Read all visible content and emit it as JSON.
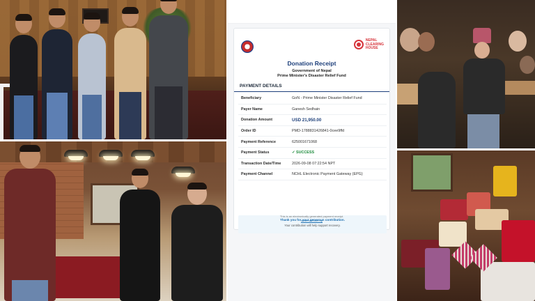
{
  "receipt": {
    "title": "Donation Receipt",
    "government": "Government of Nepal",
    "fund": "Prime Minister's Disaster Relief Fund",
    "logo_text_1": "NEPAL",
    "logo_text_2": "CLEARING",
    "logo_text_3": "HOUSE",
    "section": "PAYMENT DETAILS",
    "rows": [
      {
        "label": "Beneficiary",
        "value": "GoN - Prime Minister Disaster Relief Fund"
      },
      {
        "label": "Payer Name",
        "value": "Ganesh Sedhain"
      },
      {
        "label": "Donation Amount",
        "value": "USD 21,950.00"
      },
      {
        "label": "Order ID",
        "value": "PMD-1788831426841-0cee9ffd"
      },
      {
        "label": "Payment Reference",
        "value": "625001671068"
      },
      {
        "label": "Payment Status",
        "value": "✓ SUCCESS"
      },
      {
        "label": "Transaction Date/Time",
        "value": "2026-09-08 07:22:54 NPT"
      },
      {
        "label": "Payment Channel",
        "value": "NCHL Electronic Payment Gateway (EPG)"
      }
    ],
    "thanks": "Thank you for your generous contribution.",
    "support": "Your contribution will help support recovery.",
    "footer": "This is an electronically generated payment receipt.",
    "footer_link": "www.nchl.com.np"
  },
  "colors": {
    "brand_blue": "#1d3f7a",
    "nch_red": "#d6333a",
    "success_green": "#1b8a3a"
  }
}
